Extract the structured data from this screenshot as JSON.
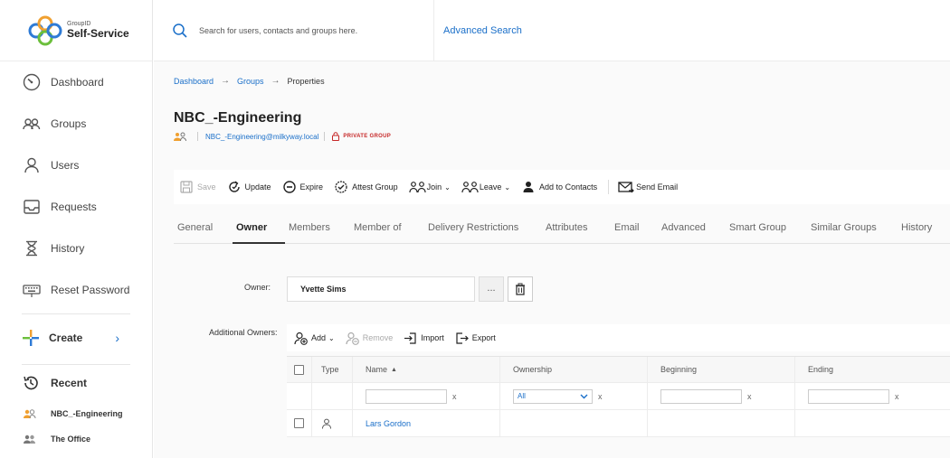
{
  "brand": {
    "small": "GroupID",
    "name": "Self-Service"
  },
  "sidebar": {
    "items": [
      {
        "label": "Dashboard",
        "icon": "dashboard-icon"
      },
      {
        "label": "Groups",
        "icon": "groups-icon"
      },
      {
        "label": "Users",
        "icon": "user-icon"
      },
      {
        "label": "Requests",
        "icon": "inbox-icon"
      },
      {
        "label": "History",
        "icon": "hourglass-icon"
      },
      {
        "label": "Reset Password",
        "icon": "keyboard-icon"
      }
    ],
    "create_label": "Create",
    "recent_label": "Recent",
    "recent_items": [
      {
        "label": "NBC_-Engineering"
      },
      {
        "label": "The Office"
      }
    ]
  },
  "topbar": {
    "search_placeholder": "Search for users, contacts and groups here.",
    "advanced_search": "Advanced Search"
  },
  "breadcrumb": {
    "items": [
      "Dashboard",
      "Groups"
    ],
    "current": "Properties",
    "separator": "→"
  },
  "group": {
    "name": "NBC_-Engineering",
    "email": "NBC_-Engineering@milkyway.local",
    "privacy": "PRIVATE GROUP"
  },
  "toolbar": {
    "save": "Save",
    "update": "Update",
    "expire": "Expire",
    "attest": "Attest Group",
    "join": "Join",
    "leave": "Leave",
    "add_contacts": "Add to Contacts",
    "send_email": "Send Email"
  },
  "tabs": [
    {
      "label": "General"
    },
    {
      "label": "Owner",
      "active": true
    },
    {
      "label": "Members"
    },
    {
      "label": "Member of"
    },
    {
      "label": "Delivery Restrictions"
    },
    {
      "label": "Attributes"
    },
    {
      "label": "Email"
    },
    {
      "label": "Advanced"
    },
    {
      "label": "Smart Group"
    },
    {
      "label": "Similar Groups"
    },
    {
      "label": "History"
    }
  ],
  "owner": {
    "label": "Owner:",
    "value": "Yvette Sims",
    "dots": "..."
  },
  "additional_owners": {
    "label": "Additional Owners:",
    "add": "Add",
    "remove": "Remove",
    "import": "Import",
    "export": "Export",
    "columns": {
      "type": "Type",
      "name": "Name",
      "ownership": "Ownership",
      "beginning": "Beginning",
      "ending": "Ending"
    },
    "filter_clear": "x",
    "ownership_filter": "All",
    "rows": [
      {
        "name": "Lars Gordon"
      }
    ]
  },
  "colors": {
    "link": "#1a6fc9",
    "private": "#c62828",
    "accent_orange": "#f0a030"
  }
}
